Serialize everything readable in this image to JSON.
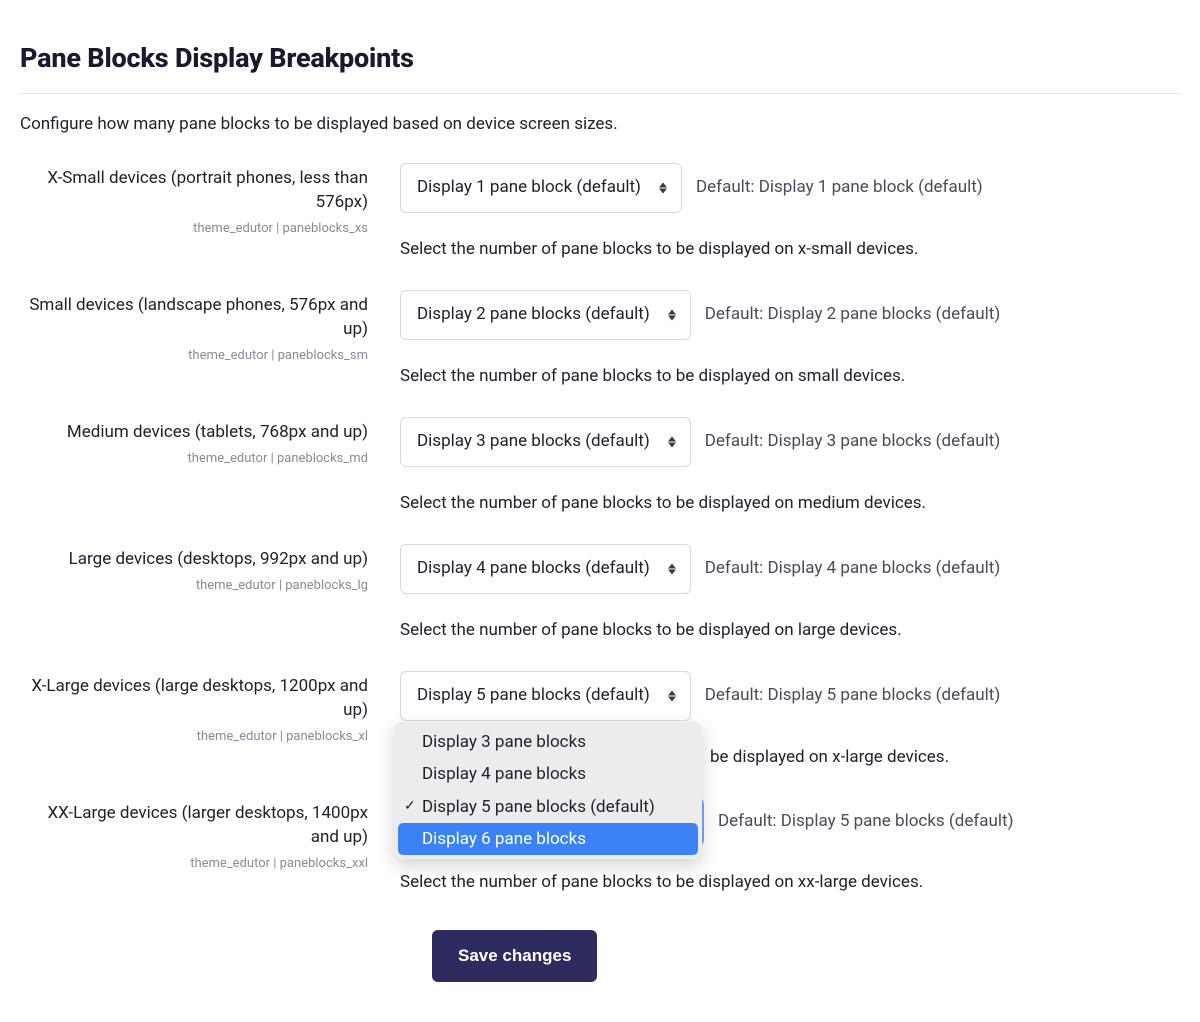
{
  "title": "Pane Blocks Display Breakpoints",
  "description": "Configure how many pane blocks to be displayed based on device screen sizes.",
  "settings": [
    {
      "label": "X-Small devices (portrait phones, less than 576px)",
      "key": "theme_edutor | paneblocks_xs",
      "selected": "Display 1 pane block (default)",
      "default": "Default: Display 1 pane block (default)",
      "help": "Select the number of pane blocks to be displayed on x-small devices."
    },
    {
      "label": "Small devices (landscape phones, 576px and up)",
      "key": "theme_edutor | paneblocks_sm",
      "selected": "Display 2 pane blocks (default)",
      "default": "Default: Display 2 pane blocks (default)",
      "help": "Select the number of pane blocks to be displayed on small devices."
    },
    {
      "label": "Medium devices (tablets, 768px and up)",
      "key": "theme_edutor | paneblocks_md",
      "selected": "Display 3 pane blocks (default)",
      "default": "Default: Display 3 pane blocks (default)",
      "help": "Select the number of pane blocks to be displayed on medium devices."
    },
    {
      "label": "Large devices (desktops, 992px and up)",
      "key": "theme_edutor | paneblocks_lg",
      "selected": "Display 4 pane blocks (default)",
      "default": "Default: Display 4 pane blocks (default)",
      "help": "Select the number of pane blocks to be displayed on large devices."
    },
    {
      "label": "X-Large devices (large desktops, 1200px and up)",
      "key": "theme_edutor | paneblocks_xl",
      "selected": "Display 5 pane blocks (default)",
      "default": "Default: Display 5 pane blocks (default)",
      "help": "be displayed on x-large devices."
    },
    {
      "label": "XX-Large devices (larger desktops, 1400px and up)",
      "key": "theme_edutor | paneblocks_xxl",
      "selected": "",
      "default": "Default: Display 5 pane blocks (default)",
      "help": "Select the number of pane blocks to be displayed on xx-large devices."
    }
  ],
  "dropdown": {
    "options": [
      {
        "label": "Display 3 pane blocks",
        "checked": false,
        "highlight": false
      },
      {
        "label": "Display 4 pane blocks",
        "checked": false,
        "highlight": false
      },
      {
        "label": "Display 5 pane blocks (default)",
        "checked": true,
        "highlight": false
      },
      {
        "label": "Display 6 pane blocks",
        "checked": false,
        "highlight": true
      }
    ]
  },
  "save_label": "Save changes"
}
